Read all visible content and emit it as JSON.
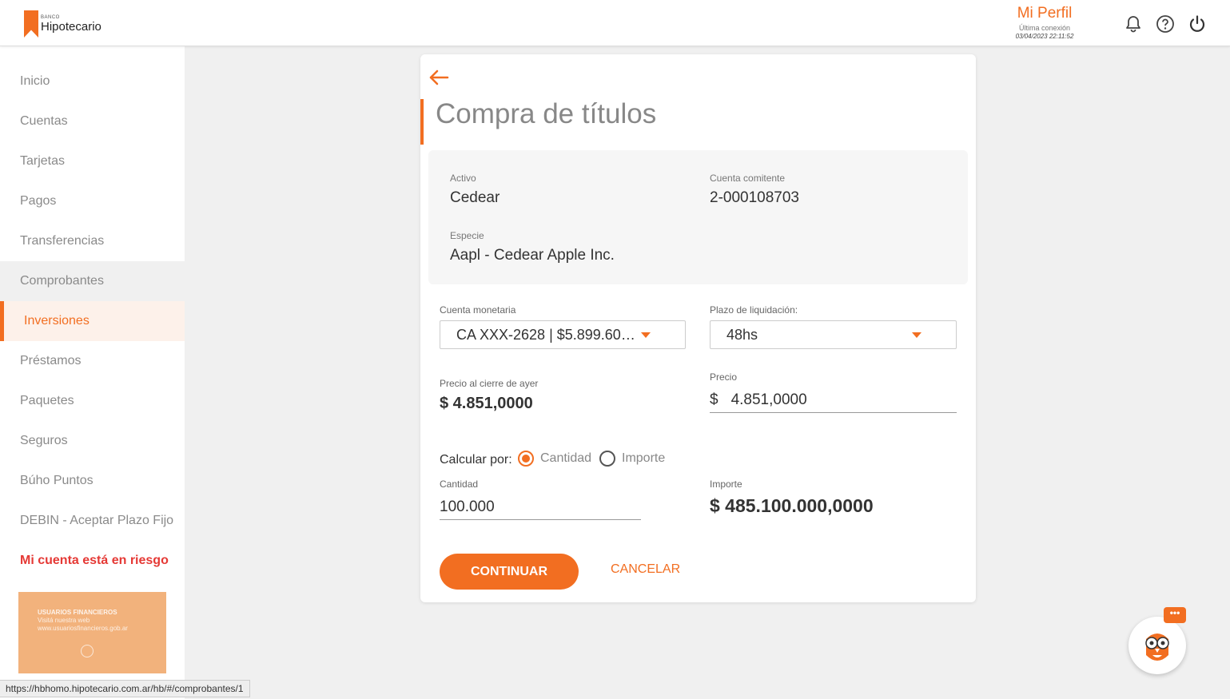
{
  "header": {
    "logo_small": "BANCO",
    "logo_main": "Hipotecario",
    "profile_name": "Mi Perfil",
    "last_connection_label": "Última conexión",
    "last_connection_date": "03/04/2023 22:11:52",
    "icons": [
      "bell-icon",
      "help-icon",
      "power-icon"
    ]
  },
  "sidebar": {
    "items": [
      {
        "label": "Inicio"
      },
      {
        "label": "Cuentas"
      },
      {
        "label": "Tarjetas"
      },
      {
        "label": "Pagos"
      },
      {
        "label": "Transferencias"
      },
      {
        "label": "Comprobantes"
      },
      {
        "label": "Inversiones"
      },
      {
        "label": "Préstamos"
      },
      {
        "label": "Paquetes"
      },
      {
        "label": "Seguros"
      },
      {
        "label": "Búho Puntos"
      },
      {
        "label": "DEBIN - Aceptar Plazo Fijo"
      },
      {
        "label": "Mi cuenta está en riesgo"
      }
    ],
    "banner": {
      "title": "USUARIOS FINANCIEROS",
      "line1": "Visitá nuestra web",
      "line2": "www.usuariosfinancieros.gob.ar"
    }
  },
  "status_bar": "https://hbhomo.hipotecario.com.ar/hb/#/comprobantes/1",
  "form": {
    "title": "Compra de títulos",
    "activo_label": "Activo",
    "activo_value": "Cedear",
    "cuenta_comitente_label": "Cuenta comitente",
    "cuenta_comitente_value": "2-000108703",
    "especie_label": "Especie",
    "especie_value": "Aapl - Cedear Apple Inc.",
    "cuenta_monetaria_label": "Cuenta monetaria",
    "cuenta_monetaria_value": "CA XXX-2628 | $5.899.601,...",
    "plazo_label": "Plazo de liquidación:",
    "plazo_value": "48hs",
    "precio_cierre_label": "Precio al cierre de ayer",
    "precio_cierre_value": "$ 4.851,0000",
    "precio_label": "Precio",
    "precio_currency": "$",
    "precio_value": "4.851,0000",
    "calcular_label": "Calcular por:",
    "radio_cantidad": "Cantidad",
    "radio_importe": "Importe",
    "cantidad_label": "Cantidad",
    "cantidad_value": "100.000",
    "importe_label": "Importe",
    "importe_value": "$ 485.100.000,0000",
    "continue_label": "CONTINUAR",
    "cancel_label": "CANCELAR"
  },
  "chat": {
    "badge": "•••"
  },
  "colors": {
    "accent": "#f26e21",
    "risk": "#e53935"
  }
}
